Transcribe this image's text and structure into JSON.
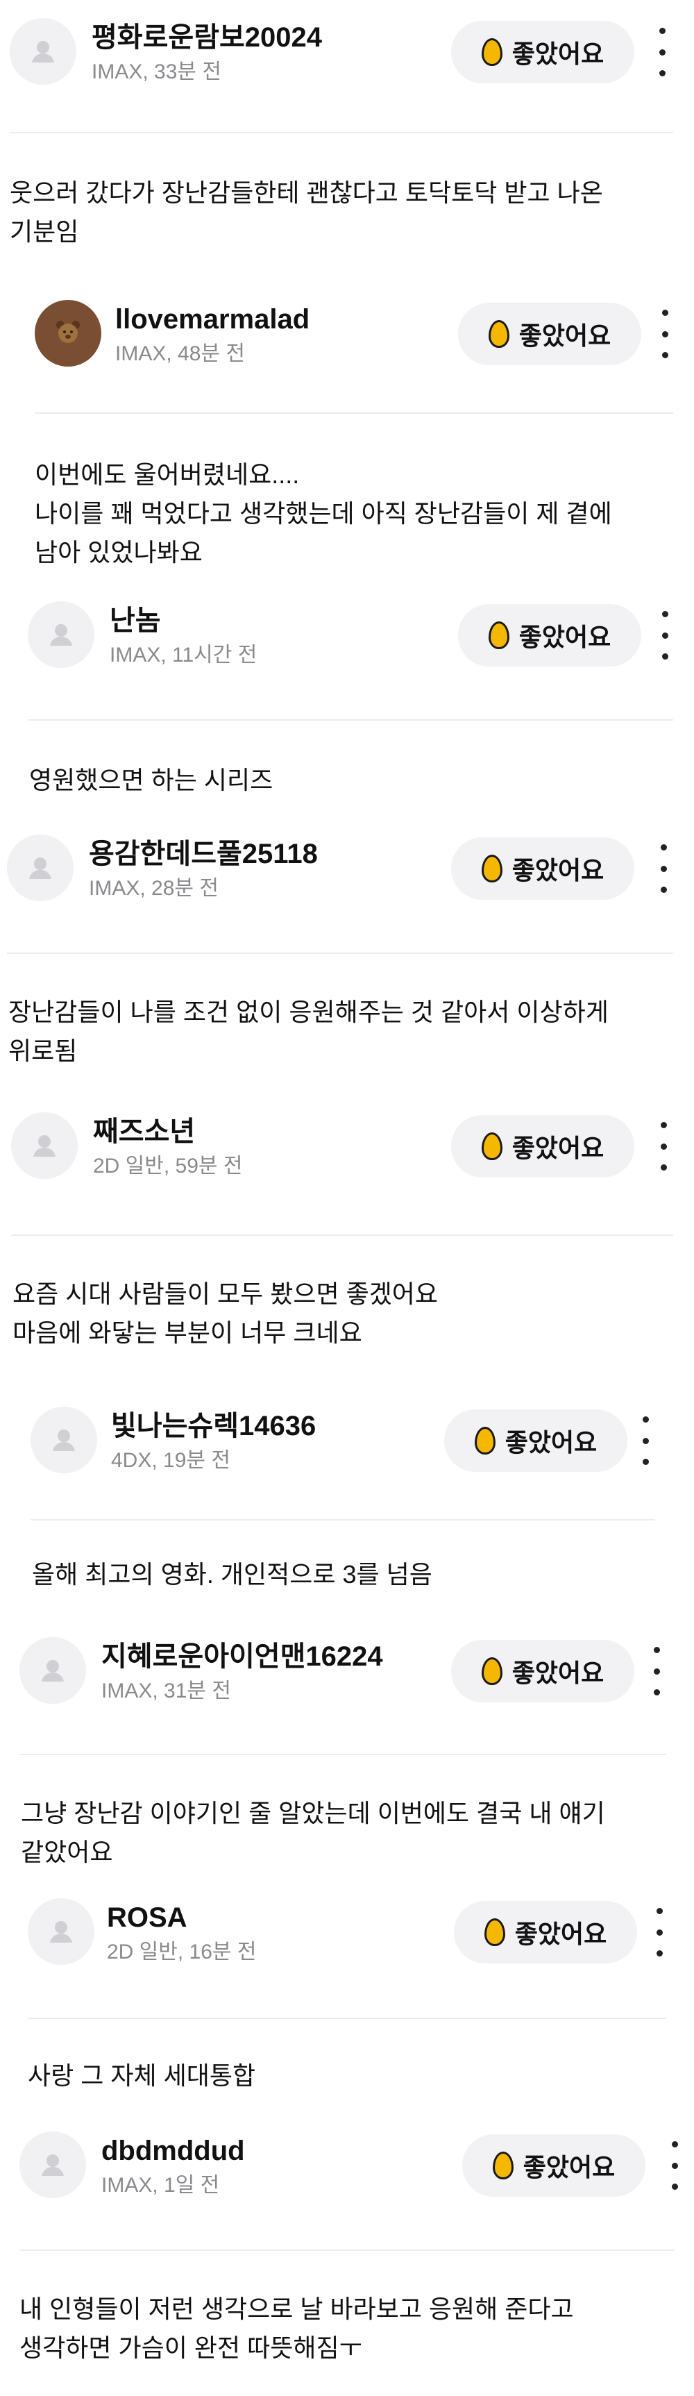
{
  "like_label": "좋았어요",
  "colors": {
    "egg": "#f5b700",
    "pill": "#f2f2f4",
    "meta": "#8a8a8e",
    "divider": "#ececec"
  },
  "icons": {
    "avatar": "user-silhouette-icon",
    "like": "golden-egg-icon",
    "menu": "more-vertical-icon"
  },
  "reviews": [
    {
      "user": "평화로운람보20024",
      "meta": "IMAX, 33분 전",
      "text": [
        "웃으러 갔다가 장난감들한테 괜찮다고 토닥토닥 받고 나온",
        "기분임"
      ]
    },
    {
      "user": "llovemarmalad",
      "meta": "IMAX, 48분 전",
      "text": [
        "이번에도 울어버렸네요....",
        "나이를 꽤 먹었다고 생각했는데 아직 장난감들이 제 곁에",
        "남아 있었나봐요"
      ]
    },
    {
      "user": "난놈",
      "meta": "IMAX, 11시간 전",
      "text": [
        "영원했으면 하는 시리즈"
      ]
    },
    {
      "user": "용감한데드풀25118",
      "meta": "IMAX, 28분 전",
      "text": [
        "장난감들이 나를 조건 없이 응원해주는 것 같아서 이상하게",
        "위로됨"
      ]
    },
    {
      "user": "째즈소년",
      "meta": "2D 일반, 59분 전",
      "text": [
        "요즘 시대 사람들이 모두 봤으면 좋겠어요",
        "마음에 와닿는 부분이 너무 크네요"
      ]
    },
    {
      "user": "빛나는슈렉14636",
      "meta": "4DX, 19분 전",
      "text": [
        "올해 최고의 영화. 개인적으로 3를 넘음"
      ]
    },
    {
      "user": "지혜로운아이언맨16224",
      "meta": "IMAX, 31분 전",
      "text": [
        "그냥 장난감 이야기인 줄 알았는데 이번에도 결국 내 얘기",
        "같았어요"
      ]
    },
    {
      "user": "ROSA",
      "meta": "2D 일반, 16분 전",
      "text": [
        "사랑 그 자체 세대통합"
      ]
    },
    {
      "user": "dbdmddud",
      "meta": "IMAX, 1일 전",
      "text": [
        "내 인형들이 저런 생각으로 날 바라보고 응원해 준다고",
        "생각하면 가슴이 완전 따뜻해짐ㅜ"
      ]
    }
  ]
}
